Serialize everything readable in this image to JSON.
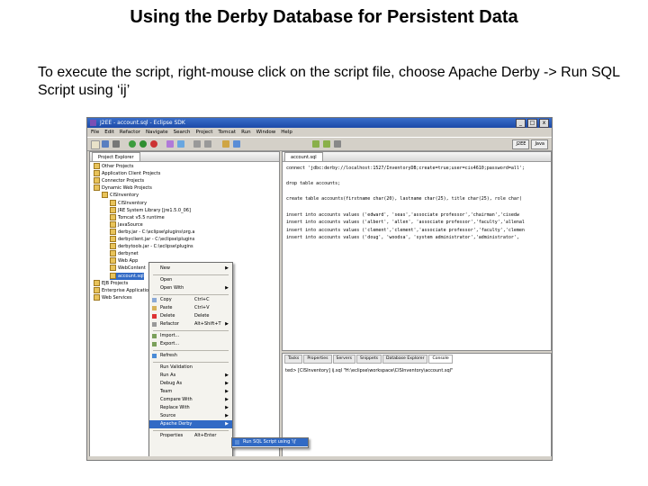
{
  "slide": {
    "title": "Using the Derby Database for Persistent Data",
    "body": "To execute the script, right-mouse click on the script file, choose Apache Derby -> Run SQL Script using ‘ij’"
  },
  "window": {
    "title": "J2EE - account.sql - Eclipse SDK",
    "controls": [
      "_",
      "□",
      "x"
    ]
  },
  "menubar": [
    "File",
    "Edit",
    "Refactor",
    "Navigate",
    "Search",
    "Project",
    "Tomcat",
    "Run",
    "Window",
    "Help"
  ],
  "perspectives": [
    "J2EE",
    "Java"
  ],
  "explorer": {
    "tab": "Project Explorer",
    "items": [
      {
        "label": "Other Projects",
        "indent": 0
      },
      {
        "label": "Application Client Projects",
        "indent": 0
      },
      {
        "label": "Connector Projects",
        "indent": 0
      },
      {
        "label": "Dynamic Web Projects",
        "indent": 0
      },
      {
        "label": "CISInventory",
        "indent": 1
      },
      {
        "label": "CISInventory",
        "indent": 2
      },
      {
        "label": "JRE System Library [jre1.5.0_06]",
        "indent": 2
      },
      {
        "label": "Tomcat v5.5 runtime",
        "indent": 2
      },
      {
        "label": "JavaSource",
        "indent": 2
      },
      {
        "label": "derby.jar - C:\\eclipse\\plugins\\org.a",
        "indent": 2
      },
      {
        "label": "derbyclient.jar - C:\\eclipse\\plugins",
        "indent": 2
      },
      {
        "label": "derbytools.jar - C:\\eclipse\\plugins",
        "indent": 2
      },
      {
        "label": "derbynet",
        "indent": 2
      },
      {
        "label": "Web App",
        "indent": 2
      },
      {
        "label": "WebContent",
        "indent": 2
      },
      {
        "label": "account.sql",
        "indent": 2,
        "selected": true
      },
      {
        "label": "EJB Projects",
        "indent": 0
      },
      {
        "label": "Enterprise Application Projects",
        "indent": 0
      },
      {
        "label": "Web Services",
        "indent": 0
      }
    ]
  },
  "editor": {
    "tab": "account.sql",
    "lines": [
      "connect 'jdbc:derby://localhost:1527/InventoryDB;create=true;user=cis4610;password=all';",
      "",
      "drop table accounts;",
      "",
      "create table accounts(firstname char(20), lastname char(25), title char(25), role char(",
      "",
      "insert into accounts values ('edward', 'seas','associate professor','chairman','cisedw",
      "insert into accounts values ('albert', 'allen', 'associate professor','faculty','allenal",
      "insert into accounts values ('clement','clement','associate professor','faculty','clemen",
      "insert into accounts values ('doug', 'woodsa', 'system administrator','administrator',"
    ]
  },
  "console": {
    "tabs": [
      "Tasks",
      "Properties",
      "Servers",
      "Snippets",
      "Database Explorer",
      "Console"
    ],
    "active_tab": "Console",
    "text": "ted> [CISInventory] ij.sql \"H:\\eclipse\\workspace\\CISInventory\\account.sql\""
  },
  "context_menu": {
    "items": [
      {
        "label": "New",
        "arrow": true
      },
      {
        "sep": true
      },
      {
        "label": "Open"
      },
      {
        "label": "Open With",
        "arrow": true
      },
      {
        "sep": true
      },
      {
        "label": "Copy",
        "shortcut": "Ctrl+C"
      },
      {
        "label": "Paste",
        "shortcut": "Ctrl+V"
      },
      {
        "label": "Delete",
        "shortcut": "Delete"
      },
      {
        "label": "Refactor",
        "shortcut": "Alt+Shift+T",
        "arrow": true
      },
      {
        "sep": true
      },
      {
        "label": "Import..."
      },
      {
        "label": "Export..."
      },
      {
        "sep": true
      },
      {
        "label": "Refresh"
      },
      {
        "sep": true
      },
      {
        "label": "Run Validation"
      },
      {
        "label": "Run As",
        "arrow": true
      },
      {
        "label": "Debug As",
        "arrow": true
      },
      {
        "label": "Team",
        "arrow": true
      },
      {
        "label": "Compare With",
        "arrow": true
      },
      {
        "label": "Replace With",
        "arrow": true
      },
      {
        "label": "Source",
        "arrow": true
      },
      {
        "label": "Apache Derby",
        "arrow": true,
        "highlighted": true
      },
      {
        "sep": true
      },
      {
        "label": "Properties",
        "shortcut": "Alt+Enter"
      }
    ],
    "submenu": {
      "label": "Run SQL Script using 'ij'"
    }
  },
  "colors": {
    "selection": "#316ac5",
    "titlebar": "#1c4aa8",
    "chrome": "#d4d0c8"
  }
}
